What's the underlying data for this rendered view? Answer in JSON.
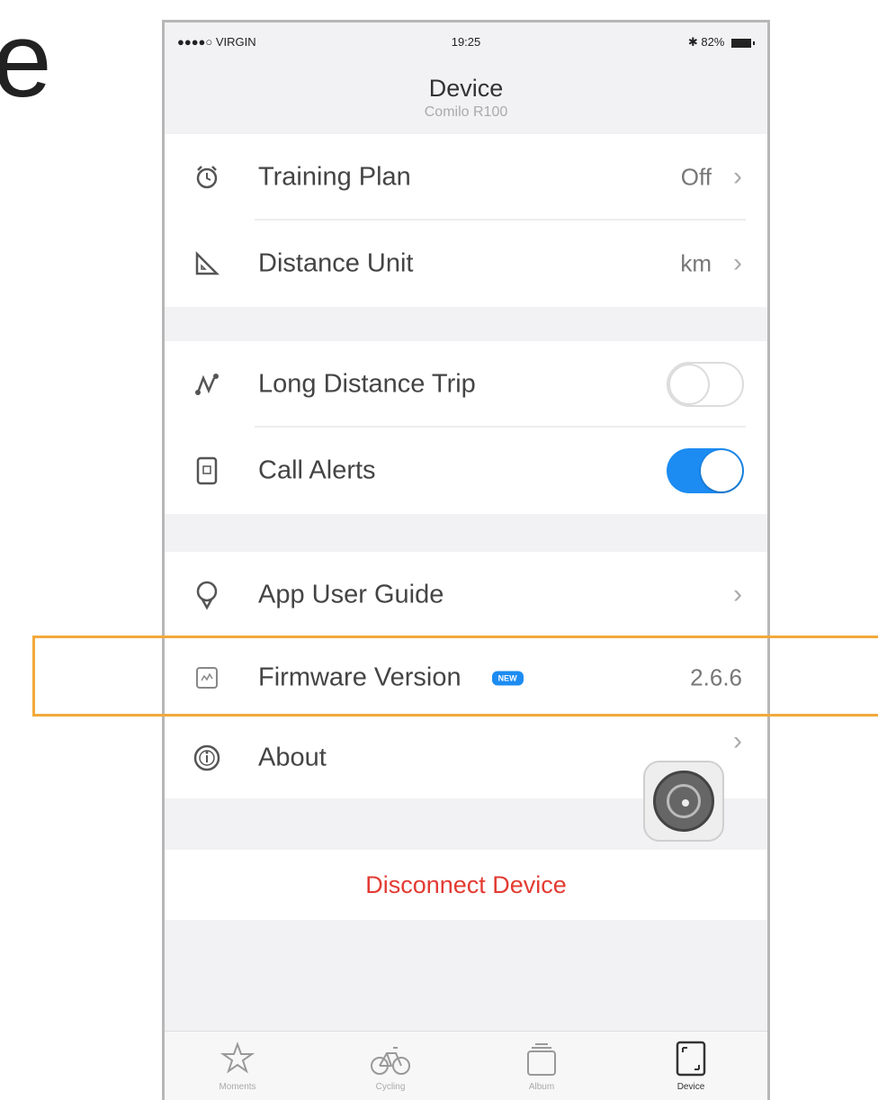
{
  "slide": {
    "partial_letter": "e"
  },
  "status_bar": {
    "carrier": "●●●●○ VIRGIN",
    "time": "19:25",
    "battery": "82%"
  },
  "nav": {
    "title": "Device",
    "subtitle": "Comilo R100"
  },
  "settings": {
    "training_plan": {
      "label": "Training Plan",
      "value": "Off",
      "icon": "alarm-clock-icon"
    },
    "distance_unit": {
      "label": "Distance Unit",
      "value": "km",
      "icon": "ruler-triangle-icon"
    },
    "long_distance_trip": {
      "label": "Long Distance Trip",
      "enabled": false,
      "icon": "route-icon"
    },
    "call_alerts": {
      "label": "Call Alerts",
      "enabled": true,
      "icon": "phone-device-icon"
    },
    "app_user_guide": {
      "label": "App User Guide",
      "icon": "lightbulb-icon"
    },
    "firmware_version": {
      "label": "Firmware Version",
      "badge": "NEW",
      "value": "2.6.6",
      "icon": "firmware-chip-icon"
    },
    "about": {
      "label": "About",
      "icon": "info-circle-icon"
    }
  },
  "disconnect": {
    "label": "Disconnect Device"
  },
  "colors": {
    "accent": "#1c8cf2",
    "danger": "#e33b32",
    "highlight": "#f2a93b"
  },
  "tabs": [
    {
      "label": "Moments",
      "icon": "star-icon",
      "active": false
    },
    {
      "label": "Cycling",
      "icon": "bicycle-icon",
      "active": false
    },
    {
      "label": "Album",
      "icon": "album-stack-icon",
      "active": false
    },
    {
      "label": "Device",
      "icon": "device-frame-icon",
      "active": true
    }
  ]
}
